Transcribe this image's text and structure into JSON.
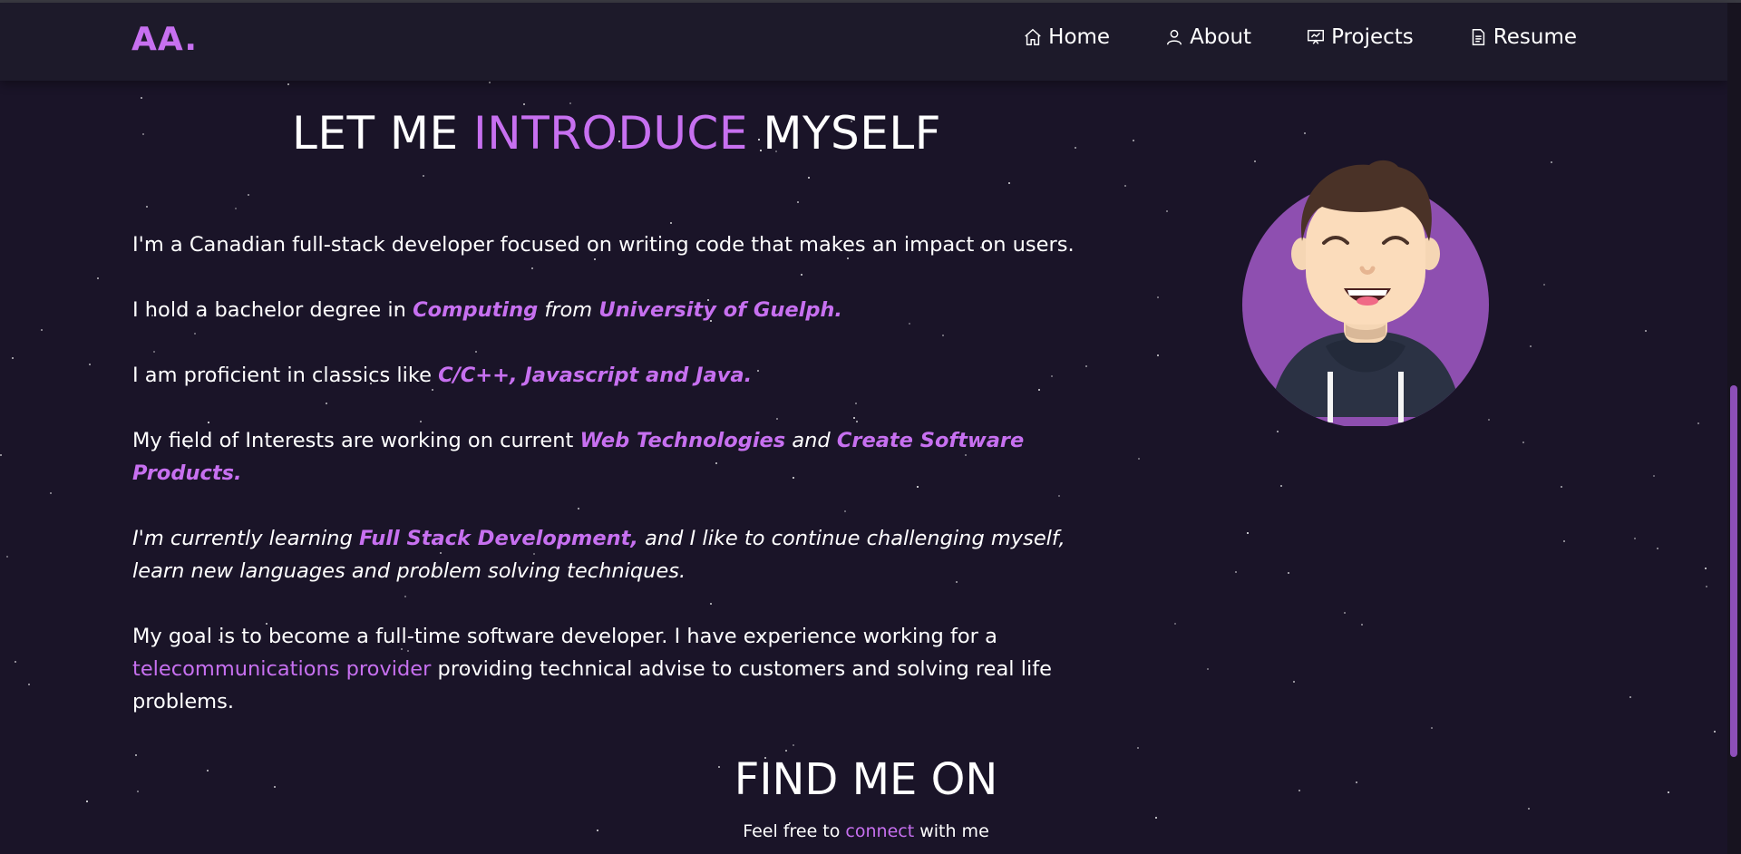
{
  "nav": {
    "logo": "AA.",
    "items": [
      {
        "label": "Home",
        "icon": "home-icon"
      },
      {
        "label": "About",
        "icon": "user-icon"
      },
      {
        "label": "Projects",
        "icon": "presentation-icon"
      },
      {
        "label": "Resume",
        "icon": "document-icon"
      }
    ]
  },
  "intro": {
    "title_pre": "LET ME",
    "title_accent": "INTRODUCE",
    "title_post": "MYSELF"
  },
  "paragraphs": {
    "p1": "I'm a Canadian full-stack developer focused on writing code that makes an impact on users.",
    "p2_a": "I hold a bachelor degree in ",
    "p2_b": "Computing",
    "p2_c": " from ",
    "p2_d": "University of Guelph.",
    "p3_a": "I am proficient in classics like ",
    "p3_b": "C/C++, Javascript and Java.",
    "p4_a": "My field of Interests are working on current ",
    "p4_b": "Web Technologies",
    "p4_c": " and ",
    "p4_d": "Create Software Products.",
    "p5_a": "I'm currently learning ",
    "p5_b": "Full Stack Development,",
    "p5_c": " and I like to continue challenging myself, learn new languages and problem solving techniques.",
    "p6_a": "My goal is to become a full-time software developer. I have experience working for a ",
    "p6_b": "telecommunications provider",
    "p6_c": " providing technical advise to customers and solving real life problems."
  },
  "find": {
    "title": "FIND ME ON",
    "sub_a": "Feel free to ",
    "sub_b": "connect",
    "sub_c": " with me"
  },
  "colors": {
    "accent": "#c770f0",
    "background": "#1a1428",
    "nav": "#1d1a2a",
    "avatar_circle": "#8e4fb0"
  }
}
